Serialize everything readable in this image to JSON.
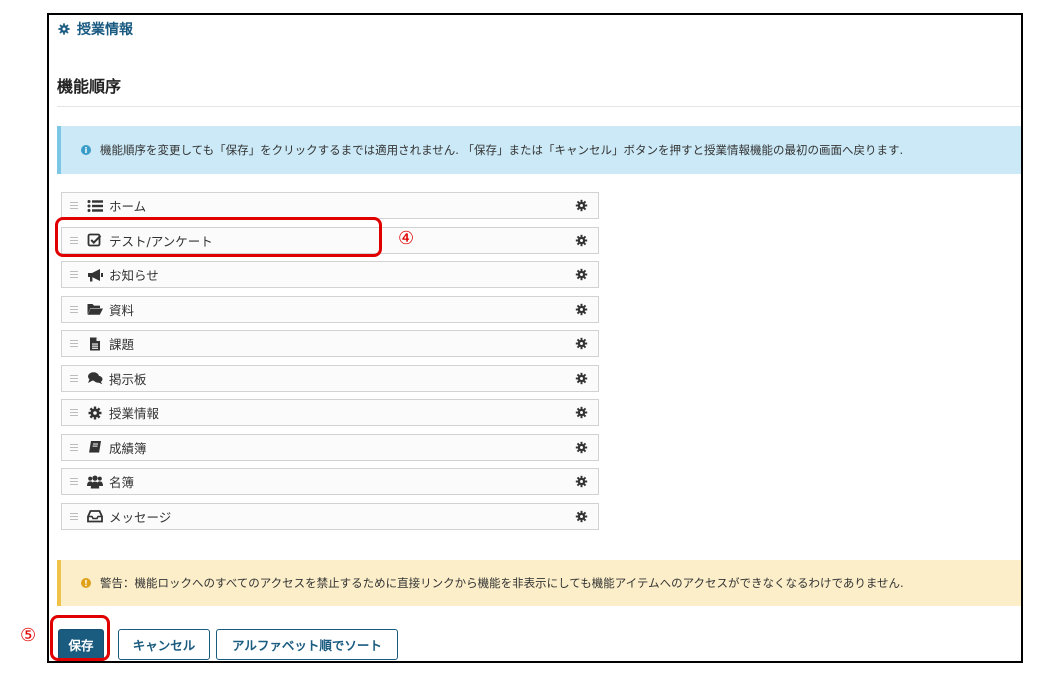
{
  "header": {
    "section_title": "授業情報",
    "section_icon": "gear-icon"
  },
  "page": {
    "title": "機能順序"
  },
  "info": {
    "text": "機能順序を変更しても「保存」をクリックするまでは適用されません. 「保存」または「キャンセル」ボタンを押すと授業情報機能の最初の画面へ戻ります."
  },
  "tools": [
    {
      "label": "ホーム",
      "icon": "list-icon"
    },
    {
      "label": "テスト/アンケート",
      "icon": "checkbox-icon"
    },
    {
      "label": "お知らせ",
      "icon": "megaphone-icon"
    },
    {
      "label": "資料",
      "icon": "folder-open-icon"
    },
    {
      "label": "課題",
      "icon": "file-text-icon"
    },
    {
      "label": "掲示板",
      "icon": "comments-icon"
    },
    {
      "label": "授業情報",
      "icon": "gear-icon"
    },
    {
      "label": "成績簿",
      "icon": "book-icon"
    },
    {
      "label": "名簿",
      "icon": "users-icon"
    },
    {
      "label": "メッセージ",
      "icon": "inbox-icon"
    }
  ],
  "warning": {
    "text": "警告：機能ロックへのすべてのアクセスを禁止するために直接リンクから機能を非表示にしても機能アイテムへのアクセスができなくなるわけでありません."
  },
  "buttons": {
    "save": "保存",
    "cancel": "キャンセル",
    "sort": "アルファベット順でソート"
  },
  "annotations": {
    "step4": "④",
    "step5": "⑤"
  },
  "colors": {
    "primary": "#1a5b80",
    "highlight": "#e00000",
    "info_bg": "#cbe9f6",
    "warn_bg": "#fbeec9"
  }
}
